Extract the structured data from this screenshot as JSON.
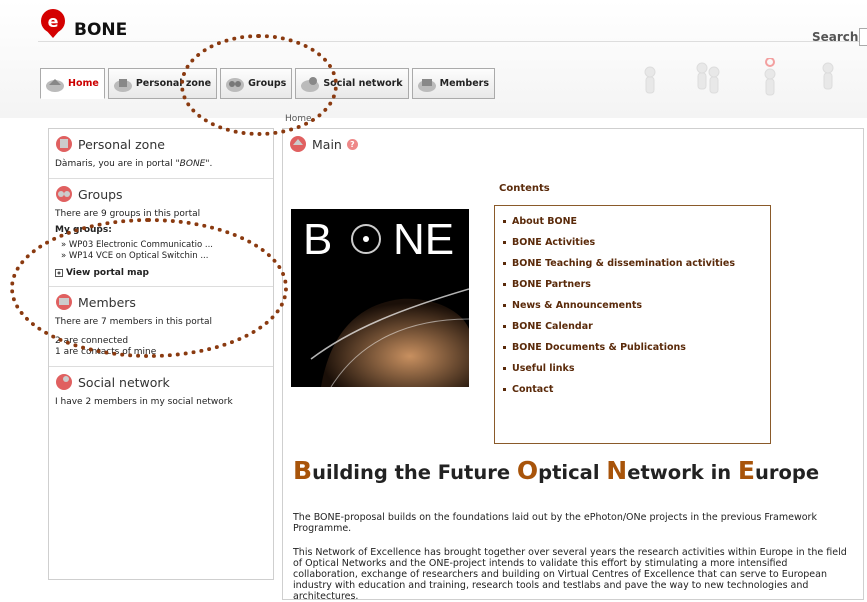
{
  "app": {
    "title": "BONE"
  },
  "search": {
    "label": "Search"
  },
  "tabs": [
    {
      "label": "Home",
      "icon": "home-icon"
    },
    {
      "label": "Personal zone",
      "icon": "personal-zone-icon"
    },
    {
      "label": "Groups",
      "icon": "groups-icon"
    },
    {
      "label": "Social network",
      "icon": "social-network-icon"
    },
    {
      "label": "Members",
      "icon": "members-icon"
    }
  ],
  "breadcrumb": "Home",
  "sidebar": {
    "personal_zone": {
      "title": "Personal zone",
      "text_prefix": "Dàmaris, you are in portal ",
      "portal_name": "\"BONE\"",
      "text_suffix": "."
    },
    "groups": {
      "title": "Groups",
      "count_text": "There are 9 groups in this portal",
      "my_groups_label": "My groups:",
      "items": [
        "» WP03 Electronic Communicatio ...",
        "» WP14 VCE on Optical Switchin ..."
      ],
      "portal_map_link": "View portal map"
    },
    "members": {
      "title": "Members",
      "count_text": "There are 7 members in this portal",
      "connected_text": "2 are connected",
      "contacts_text": "1 are contacts of mine"
    },
    "social_network": {
      "title": "Social network",
      "text": "I have 2 members in my social network"
    }
  },
  "main": {
    "title": "Main",
    "help": "?",
    "contents_title": "Contents",
    "image_text": {
      "left": "B",
      "right": "NE"
    },
    "contents": [
      "About BONE",
      "BONE Activities",
      "BONE Teaching & dissemination activities",
      "BONE Partners",
      "News & Announcements",
      "BONE Calendar",
      "BONE Documents & Publications",
      "Useful links",
      "Contact"
    ],
    "headline": [
      {
        "cap": "B",
        "rest": "uilding the Future "
      },
      {
        "cap": "O",
        "rest": "ptical "
      },
      {
        "cap": "N",
        "rest": "etwork in "
      },
      {
        "cap": "E",
        "rest": "urope"
      }
    ],
    "para1": "The BONE-proposal builds on the foundations laid out by the ePhoton/ONe projects in the previous Framework Programme.",
    "para2": "This Network of Excellence has brought together over several years the research activities within Europe in the field of Optical Networks and the ONE-project intends to validate this effort by stimulating a more intensified collaboration, exchange of researchers and building on Virtual Centres of Excellence that can serve to European industry with education and training, research tools and testlabs and pave the way to new technologies and architectures."
  },
  "colors": {
    "accent": "#cc0000",
    "brand_brown": "#5a2a0a",
    "annotation": "#8a3a10"
  }
}
